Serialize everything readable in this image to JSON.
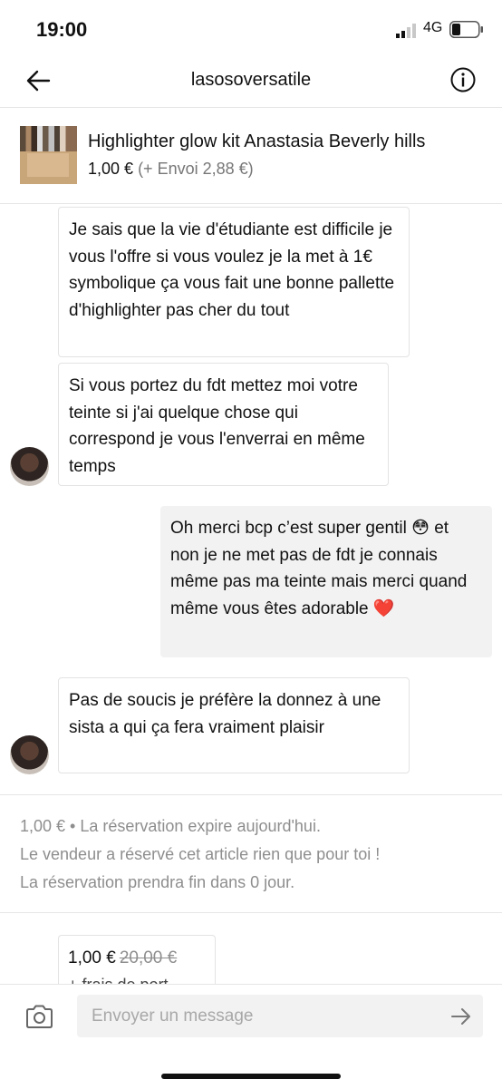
{
  "status_bar": {
    "time": "19:00",
    "network": "4G"
  },
  "header": {
    "title": "lasosoversatile"
  },
  "item": {
    "title": "Highlighter  glow  kit Anastasia Beverly hills",
    "price": "1,00 €",
    "shipping": "(+ Envoi 2,88 €)"
  },
  "messages": [
    {
      "text": "Je sais que la vie d'étudiante  est difficile  je vous l'offre si vous  voulez je la met à 1€ symbolique ça  vous fait une bonne pallette d'highlighter pas cher du tout"
    },
    {
      "text": "Si vous portez du fdt mettez moi votre  teinte si j'ai  quelque  chose qui correspond  je vous  l'enverrai en même  temps"
    },
    {
      "text": "Oh merci bcp c’est super gentil 😳 et non je ne met pas de fdt je connais même pas ma teinte mais merci quand même vous êtes adorable ❤️"
    },
    {
      "text": "Pas de soucis je préfère  la donnez à une sista  a qui ça  fera  vraiment plaisir"
    }
  ],
  "reservation": {
    "line1": "1,00 € • La réservation expire aujourd'hui.",
    "line2": "Le vendeur a réservé cet article rien que pour toi !",
    "line3": "La réservation prendra fin dans 0 jour."
  },
  "offer": {
    "price": "1,00 €",
    "old_price": "20,00 €",
    "fees": "+ frais de port"
  },
  "composer": {
    "placeholder": "Envoyer un message"
  }
}
